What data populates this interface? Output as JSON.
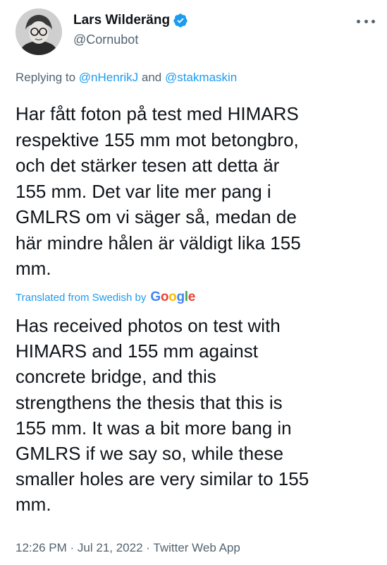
{
  "author": {
    "display_name": "Lars Wilderäng",
    "handle": "@Cornubot",
    "verified": true,
    "avatar_icon": "avatar-portrait"
  },
  "replying": {
    "prefix": "Replying to",
    "mention_1": "@nHenrikJ",
    "conjunction": "and",
    "mention_2": "@stakmaskin"
  },
  "tweet_text_lines": [
    "Har fått foton på test med HIMARS",
    "respektive 155 mm mot betongbro,",
    "och det stärker tesen att detta är",
    "155 mm. Det var lite mer pang i",
    "GMLRS om vi säger så, medan de",
    "här mindre hålen är väldigt lika 155",
    "mm."
  ],
  "translation": {
    "label": "Translated from Swedish by",
    "provider": "Google",
    "lines": [
      "Has received photos on test with",
      "HIMARS and 155 mm against",
      "concrete bridge, and this",
      "strengthens the thesis that this is",
      "155 mm. It was a bit more bang in",
      "GMLRS if we say so, while these",
      "smaller holes are very similar to 155",
      "mm."
    ]
  },
  "meta": {
    "time": "12:26 PM",
    "separator": "·",
    "date": "Jul 21, 2022",
    "source": "Twitter Web App"
  },
  "colors": {
    "text": "#0f1419",
    "secondary": "#536471",
    "link": "#1d9bf0",
    "google_blue": "#4285F4",
    "google_red": "#EA4335",
    "google_yellow": "#FBBC05",
    "google_green": "#34A853"
  }
}
